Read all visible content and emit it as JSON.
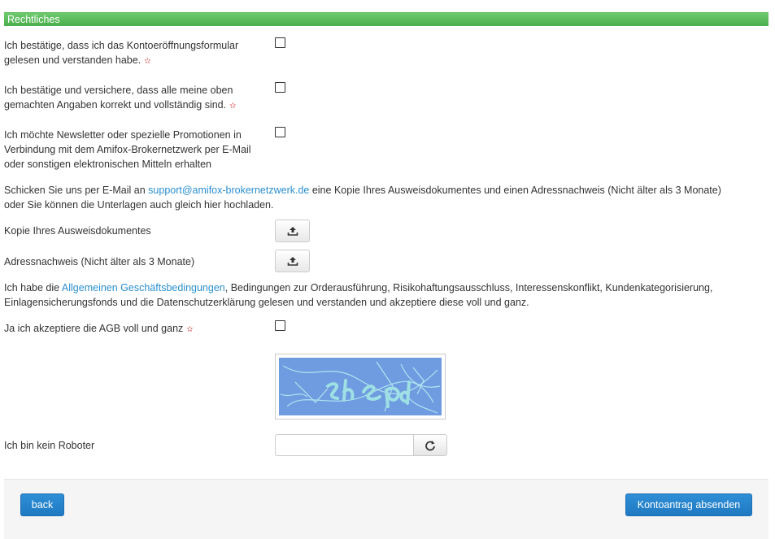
{
  "section": {
    "title": "Rechtliches"
  },
  "consents": {
    "form_read": {
      "line1": "Ich bestätige, dass ich das Kontoeröffnungsformular",
      "line2": "gelesen und verstanden habe.",
      "required_mark": "✫"
    },
    "data_correct": {
      "line1": "Ich bestätige und versichere, dass alle meine oben",
      "line2": "gemachten Angaben korrekt und vollständig sind.",
      "required_mark": "✫"
    },
    "newsletter": {
      "line1": "Ich möchte Newsletter oder spezielle Promotionen in",
      "line2": "Verbindung mit dem Amifox-Brokernetzwerk per E-Mail",
      "line3": "oder sonstigen elektronischen Mitteln erhalten"
    }
  },
  "documents_info": {
    "part1": "Schicken Sie uns per E-Mail an ",
    "email": "support@amifox-brokernetzwerk.de",
    "part2": " eine Kopie Ihres Ausweisdokumentes und einen Adressnachweis (Nicht älter als 3 Monate)",
    "line2": "oder Sie können die Unterlagen auch gleich hier hochladen."
  },
  "uploads": {
    "id_copy_label": "Kopie Ihres Ausweisdokumentes",
    "address_proof_label": "Adressnachweis (Nicht älter als 3 Monate)"
  },
  "terms": {
    "part1": "Ich habe die ",
    "link": "Allgemeinen Geschäftsbedingungen",
    "part2": ", Bedingungen zur Orderausführung, Risikohaftungsausschluss, Interessenskonflikt, Kundenkategorisierung,",
    "line2": "Einlagensicherungsfonds und die Datenschutzerklärung gelesen und verstanden und akzeptiere diese voll und ganz.",
    "accept_label": "Ja ich akzeptiere die AGB voll und ganz",
    "required_mark": "✫"
  },
  "captcha": {
    "label": "Ich bin kein Roboter",
    "input_value": "",
    "colors": {
      "background": "#6f9be0",
      "text": "#b9ecf2"
    }
  },
  "footer": {
    "back_label": "back",
    "submit_label": "Kontoantrag absenden"
  },
  "icons": {
    "upload": "upload-icon",
    "refresh": "refresh-icon"
  },
  "colors": {
    "header_green": "#5cb85c",
    "link_blue": "#2a8fd0",
    "required_red": "#d9534f",
    "button_blue": "#1f79c2"
  }
}
